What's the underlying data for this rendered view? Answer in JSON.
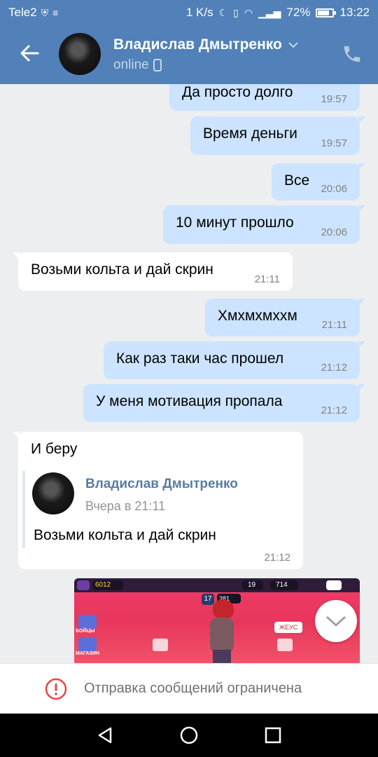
{
  "status_bar": {
    "carrier": "Tele2",
    "speed": "1 K/s",
    "battery": "72%",
    "time": "13:22"
  },
  "header": {
    "name": "Владислав Дмытренко",
    "status": "online"
  },
  "messages": [
    {
      "text": "Да просто долго",
      "time": "19:57"
    },
    {
      "text": "Время деньги",
      "time": "19:57"
    },
    {
      "text": "Все",
      "time": "20:06"
    },
    {
      "text": "10 минут прошло",
      "time": "20:06"
    },
    {
      "text": "Возьми кольта и дай скрин",
      "time": "21:11"
    },
    {
      "text": "Хмхмхмхxм",
      "time": "21:11"
    },
    {
      "text": "Как раз таки час прошел",
      "time": "21:12"
    },
    {
      "text": "У меня мотивация пропала",
      "time": "21:12"
    }
  ],
  "reply_message": {
    "text": "И беру",
    "time": "21:12",
    "quoted": {
      "author": "Владислав Дмытренко",
      "date": "Вчера в 21:11",
      "text": "Возьми кольта и дай скрин"
    }
  },
  "game_screenshot": {
    "coins": "6012",
    "trophies": "19",
    "gems": "714",
    "level": "17",
    "character_trophies": "381",
    "tag": "ЖЕУС",
    "side_labels": [
      "БОЙЦЫ",
      "МАГАЗИН"
    ]
  },
  "restriction_notice": "Отправка сообщений ограничена",
  "colors": {
    "accent": "#5181b8",
    "outgoing_bubble": "#cce4ff",
    "incoming_bubble": "#ffffff",
    "background": "#edeef0",
    "warning": "#e64646"
  },
  "icons": [
    "back-arrow-icon",
    "chevron-down-icon",
    "mobile-icon",
    "phone-icon",
    "scroll-down-icon",
    "warning-icon",
    "nav-back-icon",
    "nav-home-icon",
    "nav-recent-icon"
  ]
}
